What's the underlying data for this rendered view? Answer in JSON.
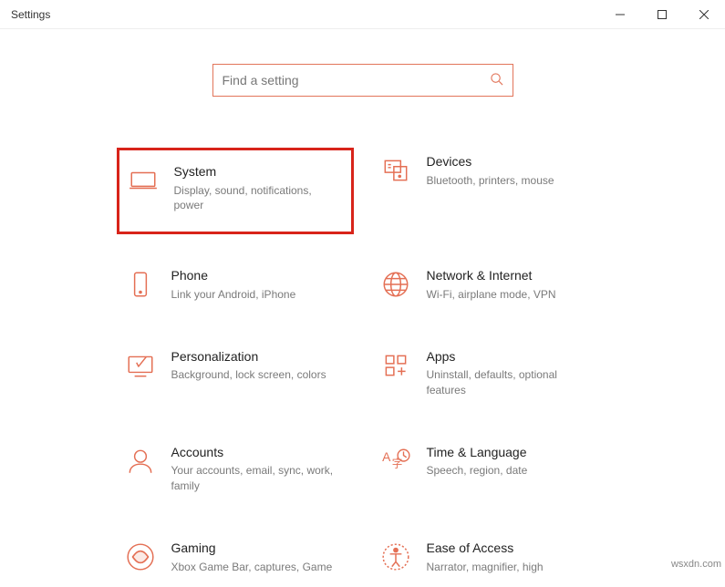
{
  "window": {
    "title": "Settings"
  },
  "search": {
    "placeholder": "Find a setting"
  },
  "tiles": [
    {
      "title": "System",
      "desc": "Display, sound, notifications, power"
    },
    {
      "title": "Devices",
      "desc": "Bluetooth, printers, mouse"
    },
    {
      "title": "Phone",
      "desc": "Link your Android, iPhone"
    },
    {
      "title": "Network & Internet",
      "desc": "Wi-Fi, airplane mode, VPN"
    },
    {
      "title": "Personalization",
      "desc": "Background, lock screen, colors"
    },
    {
      "title": "Apps",
      "desc": "Uninstall, defaults, optional features"
    },
    {
      "title": "Accounts",
      "desc": "Your accounts, email, sync, work, family"
    },
    {
      "title": "Time & Language",
      "desc": "Speech, region, date"
    },
    {
      "title": "Gaming",
      "desc": "Xbox Game Bar, captures, Game"
    },
    {
      "title": "Ease of Access",
      "desc": "Narrator, magnifier, high"
    }
  ],
  "watermark": "wsxdn.com"
}
